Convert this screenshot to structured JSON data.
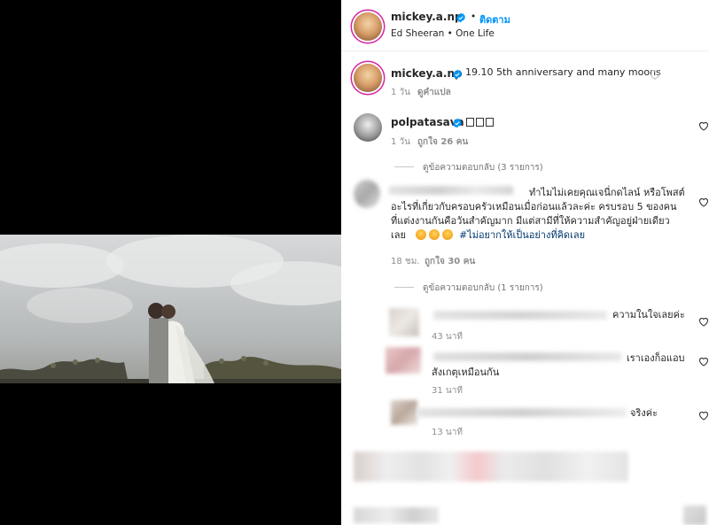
{
  "header": {
    "username": "mickey.a.np",
    "separator": "•",
    "follow_label": "ติดตาม",
    "audio": "Ed Sheeran • One Life"
  },
  "caption": {
    "username": "mickey.a.np",
    "text": "19.10 5th anniversary and many moons",
    "time": "1 วัน",
    "translate": "ดูคำแปล"
  },
  "comments": [
    {
      "username": "polpatasava",
      "text": "",
      "time": "1 วัน",
      "likes": "ถูกใจ 26 คน",
      "replies": "ดูข้อความตอบกลับ (3 รายการ)"
    },
    {
      "text_lines": [
        "ทำไมไม่เคยคุณเจนี่กดไลน์ หรือโพสต์",
        "อะไรที่เกี่ยวกับครอบครัวเหมือนเมื่อก่อนแล้วละค่ะ ครบรอบ 5 ของคน",
        "ที่แต่งงานกันคือวันสำคัญมาก มีแต่สามีที่ให้ความสำคัญอยู่ฝ่ายเดียว"
      ],
      "last_line_prefix": "เลย",
      "hashtag": "#ไม่อยากให้เป็นอย่างที่คิดเลย",
      "time": "18 ชม.",
      "likes": "ถูกใจ 30 คน",
      "replies": "ดูข้อความตอบกลับ (1 รายการ)"
    }
  ],
  "replies": [
    {
      "text": "ความในใจเลยค่ะ",
      "time": "43 นาที"
    },
    {
      "text": "เราเองก็อแอบ",
      "text2": "สังเกตุเหมือนกัน",
      "time": "31 นาที"
    },
    {
      "text": "จริงค่ะ",
      "time": "13 นาที"
    }
  ],
  "colors": {
    "link_blue": "#0095f6",
    "hashtag": "#00376b",
    "verified": "#0095f6",
    "muted": "#8e8e8e"
  }
}
